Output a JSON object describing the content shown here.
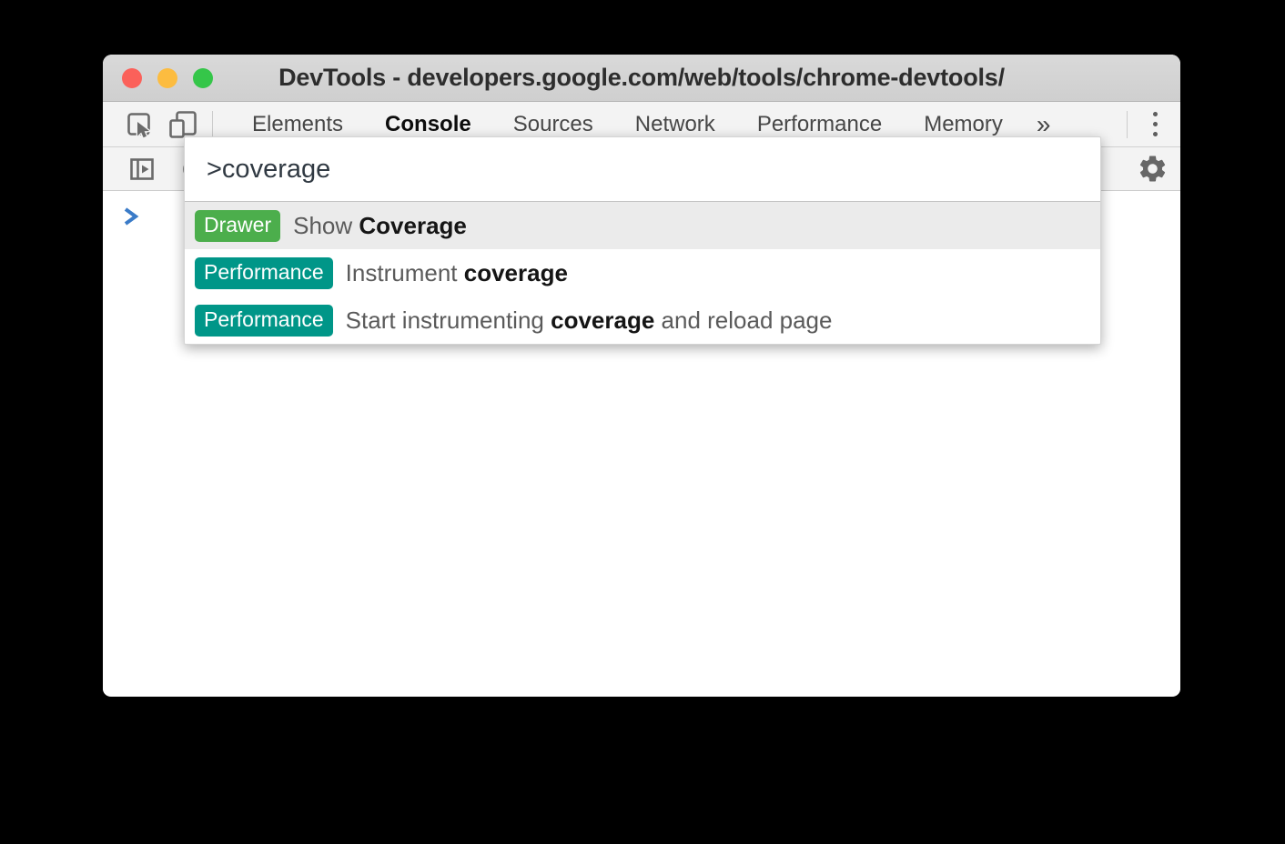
{
  "window": {
    "title": "DevTools - developers.google.com/web/tools/chrome-devtools/",
    "controls": {
      "close_color": "#fb615a",
      "minimize_color": "#fcbc40",
      "zoom_color": "#35c649"
    }
  },
  "tabbar": {
    "tabs": [
      {
        "label": "Elements",
        "selected": false
      },
      {
        "label": "Console",
        "selected": true
      },
      {
        "label": "Sources",
        "selected": false
      },
      {
        "label": "Network",
        "selected": false
      },
      {
        "label": "Performance",
        "selected": false
      },
      {
        "label": "Memory",
        "selected": false
      }
    ],
    "overflow_glyph": "»"
  },
  "command_menu": {
    "query": ">coverage",
    "results": [
      {
        "badge": "Drawer",
        "badge_color": "#4cae4c",
        "prefix": "Show ",
        "match": "Coverage",
        "suffix": ""
      },
      {
        "badge": "Performance",
        "badge_color": "#009688",
        "prefix": "Instrument ",
        "match": "coverage",
        "suffix": ""
      },
      {
        "badge": "Performance",
        "badge_color": "#009688",
        "prefix": "Start instrumenting ",
        "match": "coverage",
        "suffix": " and reload page"
      }
    ]
  },
  "console": {
    "prompt_color": "#3a7bc8"
  },
  "colors": {
    "toolbar_bg": "#f3f3f3",
    "titlebar_bg": "#d4d4d4",
    "selected_row_bg": "#ebebeb",
    "icon_gray": "#6a6a6a"
  }
}
